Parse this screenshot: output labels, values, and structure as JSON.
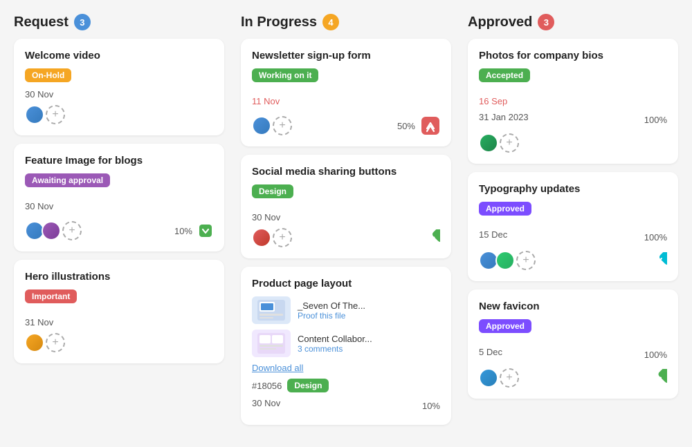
{
  "columns": [
    {
      "id": "request",
      "title": "Request",
      "badge_count": "3",
      "badge_color": "badge-blue",
      "cards": [
        {
          "id": "c1",
          "title": "Welcome video",
          "tag": "On-Hold",
          "tag_class": "tag-onhold",
          "date": "30 Nov",
          "date_class": "card-date-dark",
          "show_percent": false,
          "percent": "",
          "avatars": [
            "av1"
          ],
          "show_add": true,
          "icon": null
        },
        {
          "id": "c2",
          "title": "Feature Image for blogs",
          "tag": "Awaiting approval",
          "tag_class": "tag-awaiting",
          "date": "30 Nov",
          "date_class": "card-date-dark",
          "show_percent": true,
          "percent": "10%",
          "avatars": [
            "av1",
            "av2"
          ],
          "show_add": true,
          "icon": "chevron-down-green"
        },
        {
          "id": "c3",
          "title": "Hero illustrations",
          "tag": "Important",
          "tag_class": "tag-important",
          "date": "31 Nov",
          "date_class": "card-date-dark",
          "show_percent": false,
          "percent": "",
          "avatars": [
            "av4"
          ],
          "show_add": true,
          "icon": null
        }
      ]
    },
    {
      "id": "in-progress",
      "title": "In Progress",
      "badge_count": "4",
      "badge_color": "badge-orange",
      "cards": [
        {
          "id": "c4",
          "title": "Newsletter sign-up form",
          "tag": "Working on it",
          "tag_class": "tag-working",
          "date": "11 Nov",
          "date_class": "card-date",
          "show_percent": true,
          "percent": "50%",
          "avatars": [
            "av1"
          ],
          "show_add": true,
          "icon": "up-red",
          "type": "simple"
        },
        {
          "id": "c5",
          "title": "Social media sharing buttons",
          "tag": "Design",
          "tag_class": "tag-design",
          "date": "30 Nov",
          "date_class": "card-date-dark",
          "show_percent": false,
          "percent": "",
          "avatars": [
            "av3"
          ],
          "show_add": true,
          "icon": "diamond-green",
          "type": "simple"
        },
        {
          "id": "c6",
          "title": "Product page layout",
          "tag": null,
          "tag_class": "",
          "type": "attachments",
          "attachments": [
            {
              "name": "_Seven Of The...",
              "link_text": "Proof this file",
              "thumb_color": "#e8f0fe"
            },
            {
              "name": "Content Collabor...",
              "link_text": "3 comments",
              "thumb_color": "#f0e8fe"
            }
          ],
          "download_label": "Download all",
          "card_id": "#18056",
          "second_tag": "Design",
          "second_tag_class": "tag-design",
          "date": "30 Nov",
          "date_class": "card-date-dark",
          "show_percent": true,
          "percent": "10%",
          "avatars": [],
          "show_add": false,
          "icon": null
        }
      ]
    },
    {
      "id": "approved",
      "title": "Approved",
      "badge_count": "3",
      "badge_color": "badge-red",
      "cards": [
        {
          "id": "c7",
          "title": "Photos for company bios",
          "tag": "Accepted",
          "tag_class": "tag-accepted",
          "date": "16 Sep",
          "date_class": "card-date",
          "date2": "31 Jan 2023",
          "show_percent": true,
          "percent": "100%",
          "avatars": [
            "av5"
          ],
          "show_add": true,
          "icon": null
        },
        {
          "id": "c8",
          "title": "Typography updates",
          "tag": "Approved",
          "tag_class": "tag-approved",
          "date": "15 Dec",
          "date_class": "card-date-dark",
          "show_percent": true,
          "percent": "100%",
          "avatars": [
            "av1",
            "av6"
          ],
          "show_add": true,
          "icon": "chevron-check-teal"
        },
        {
          "id": "c9",
          "title": "New favicon",
          "tag": "Approved",
          "tag_class": "tag-approved",
          "date": "5 Dec",
          "date_class": "card-date-dark",
          "show_percent": true,
          "percent": "100%",
          "avatars": [
            "av8"
          ],
          "show_add": true,
          "icon": "diamond-dots-green"
        }
      ]
    }
  ]
}
